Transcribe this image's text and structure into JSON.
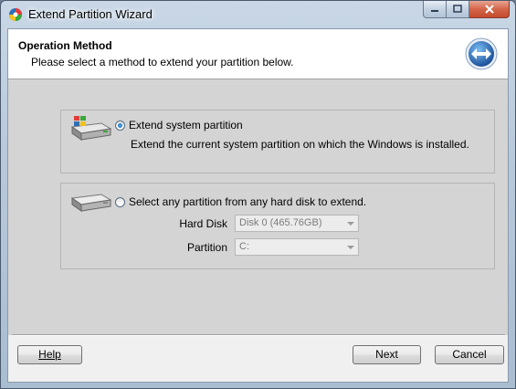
{
  "window": {
    "title": "Extend Partition Wizard",
    "buttons": {
      "minimize": "minimize",
      "maximize": "maximize",
      "close": "close"
    }
  },
  "header": {
    "title": "Operation Method",
    "subtitle": "Please select a method to extend your partition below.",
    "icon": "extend-arrows-icon"
  },
  "options": {
    "system": {
      "label": "Extend system partition",
      "description": "Extend the current system partition on which the Windows is installed.",
      "selected": true,
      "icon": "windows-disk-icon"
    },
    "any": {
      "label": "Select any partition from any hard disk to extend.",
      "selected": false,
      "icon": "hard-disk-icon",
      "hard_disk_label": "Hard Disk",
      "hard_disk_value": "Disk 0 (465.76GB)",
      "partition_label": "Partition",
      "partition_value": "C:"
    }
  },
  "footer": {
    "help": "Help",
    "next": "Next",
    "cancel": "Cancel"
  },
  "colors": {
    "accent": "#1a5fa8",
    "close_button": "#c44a2c",
    "content_bg": "#d4d4d4"
  }
}
